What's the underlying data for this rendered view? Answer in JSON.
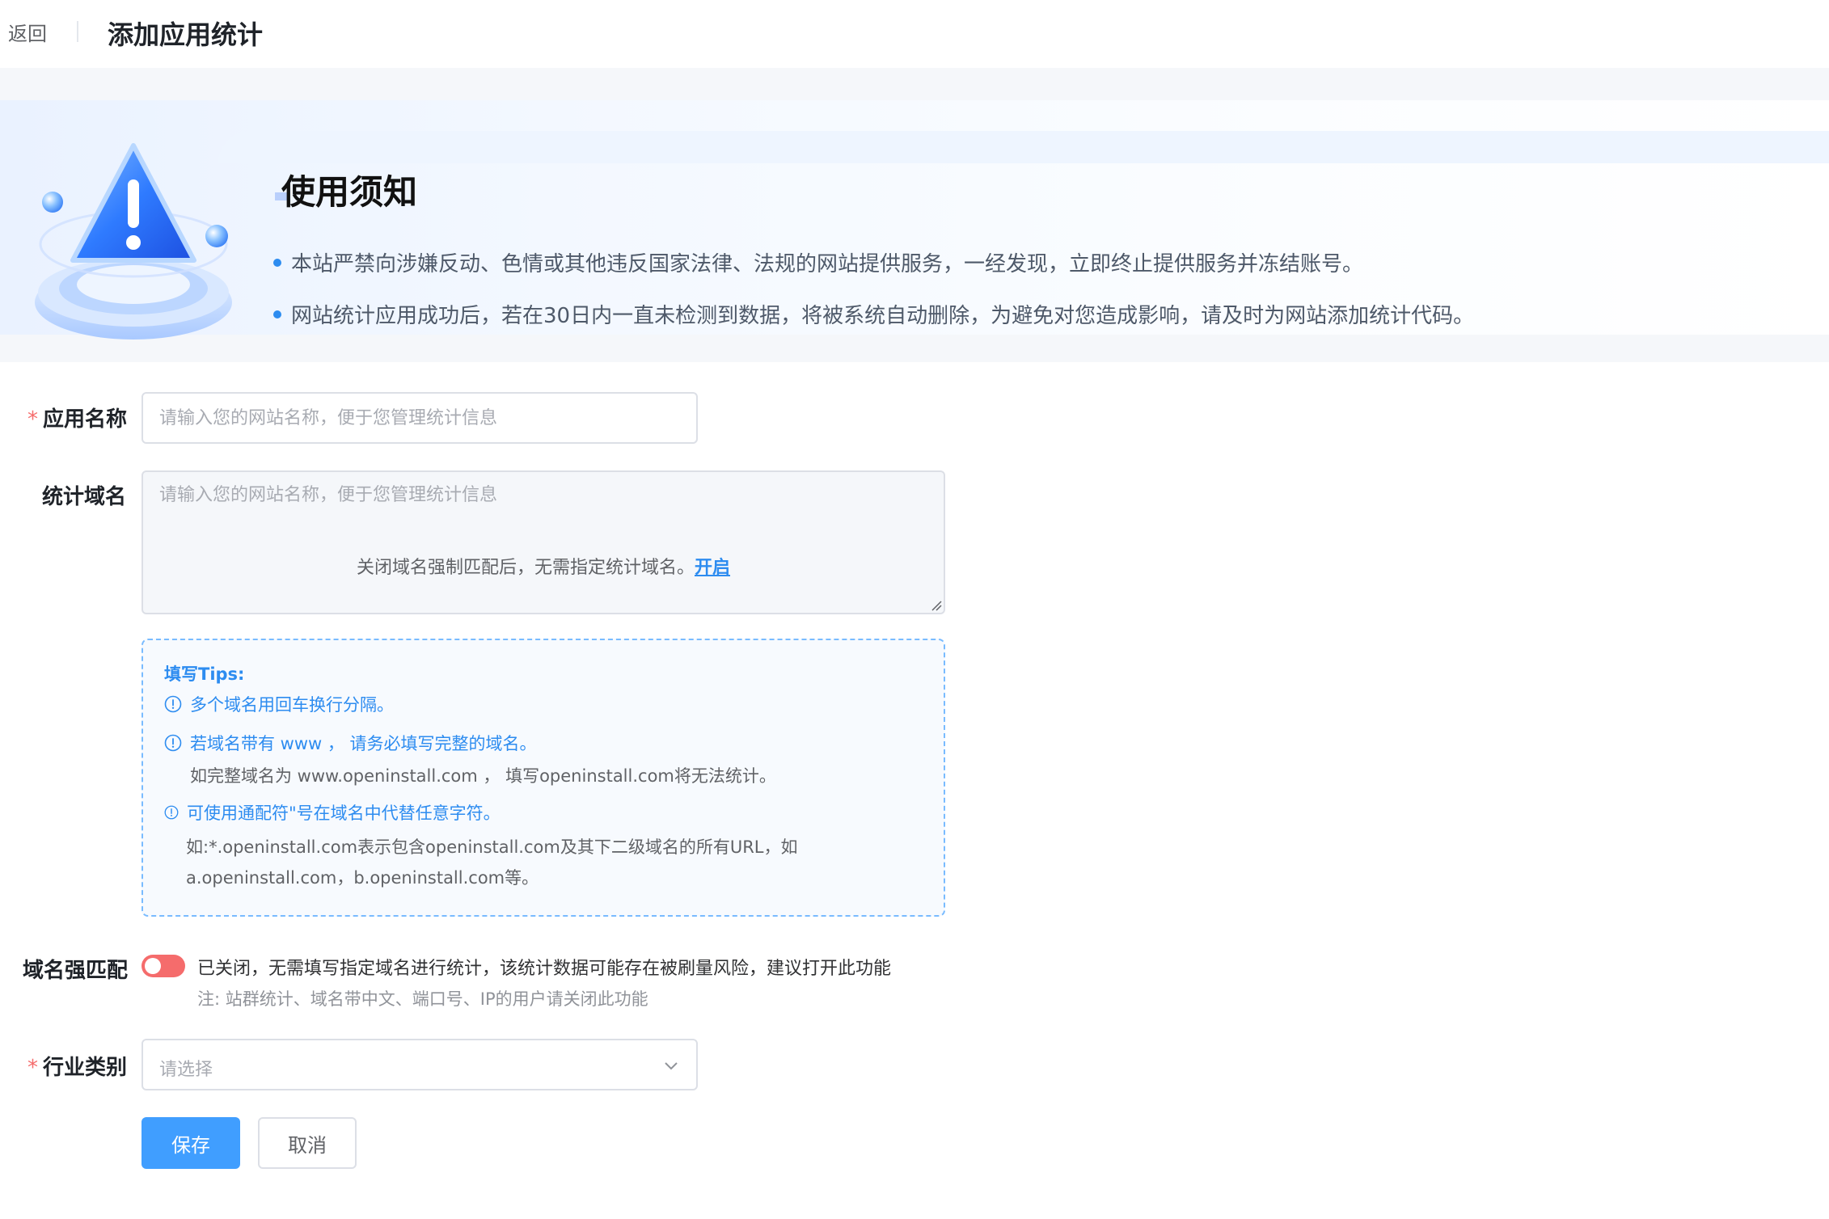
{
  "header": {
    "back_label": "返回",
    "title": "添加应用统计"
  },
  "notice": {
    "title": "使用须知",
    "items": [
      "本站严禁向涉嫌反动、色情或其他违反国家法律、法规的网站提供服务，一经发现，立即终止提供服务并冻结账号。",
      "网站统计应用成功后，若在30日内一直未检测到数据，将被系统自动删除，为避免对您造成影响，请及时为网站添加统计代码。"
    ],
    "illustration_icon": "warning-triangle-icon"
  },
  "form": {
    "required_mark": "*",
    "app_name": {
      "label": "应用名称",
      "placeholder": "请输入您的网站名称，便于您管理统计信息",
      "value": ""
    },
    "domain": {
      "label": "统计域名",
      "placeholder": "请输入您的网站名称，便于您管理统计信息",
      "overlay_text": "关闭域名强制匹配后，无需指定统计域名。",
      "overlay_link": "开启"
    },
    "tips": {
      "title": "填写Tips:",
      "tip1": "多个域名用回车换行分隔。",
      "tip2": "若域名带有 www ， 请务必填写完整的域名。",
      "tip2_sub": "如完整域名为 www.openinstall.com ， 填写openinstall.com将无法统计。",
      "tip3": "可使用通配符\"号在域名中代替任意字符。",
      "tip3_sub1": "如:*.openinstall.com表示包含openinstall.com及其下二级域名的所有URL，如",
      "tip3_sub2": "a.openinstall.com，b.openinstall.com等。",
      "icon": "info-circle-icon"
    },
    "strict_match": {
      "label": "域名强匹配",
      "enabled": false,
      "status_text": "已关闭，无需填写指定域名进行统计，该统计数据可能存在被刷量风险，建议打开此功能",
      "note": "注: 站群统计、域名带中文、端口号、IP的用户请关闭此功能",
      "off_color": "#f56c6c"
    },
    "industry": {
      "label": "行业类别",
      "placeholder": "请选择"
    },
    "buttons": {
      "save": "保存",
      "cancel": "取消"
    }
  },
  "colors": {
    "primary": "#409eff",
    "link": "#2d8cf0",
    "danger": "#f56c6c"
  }
}
